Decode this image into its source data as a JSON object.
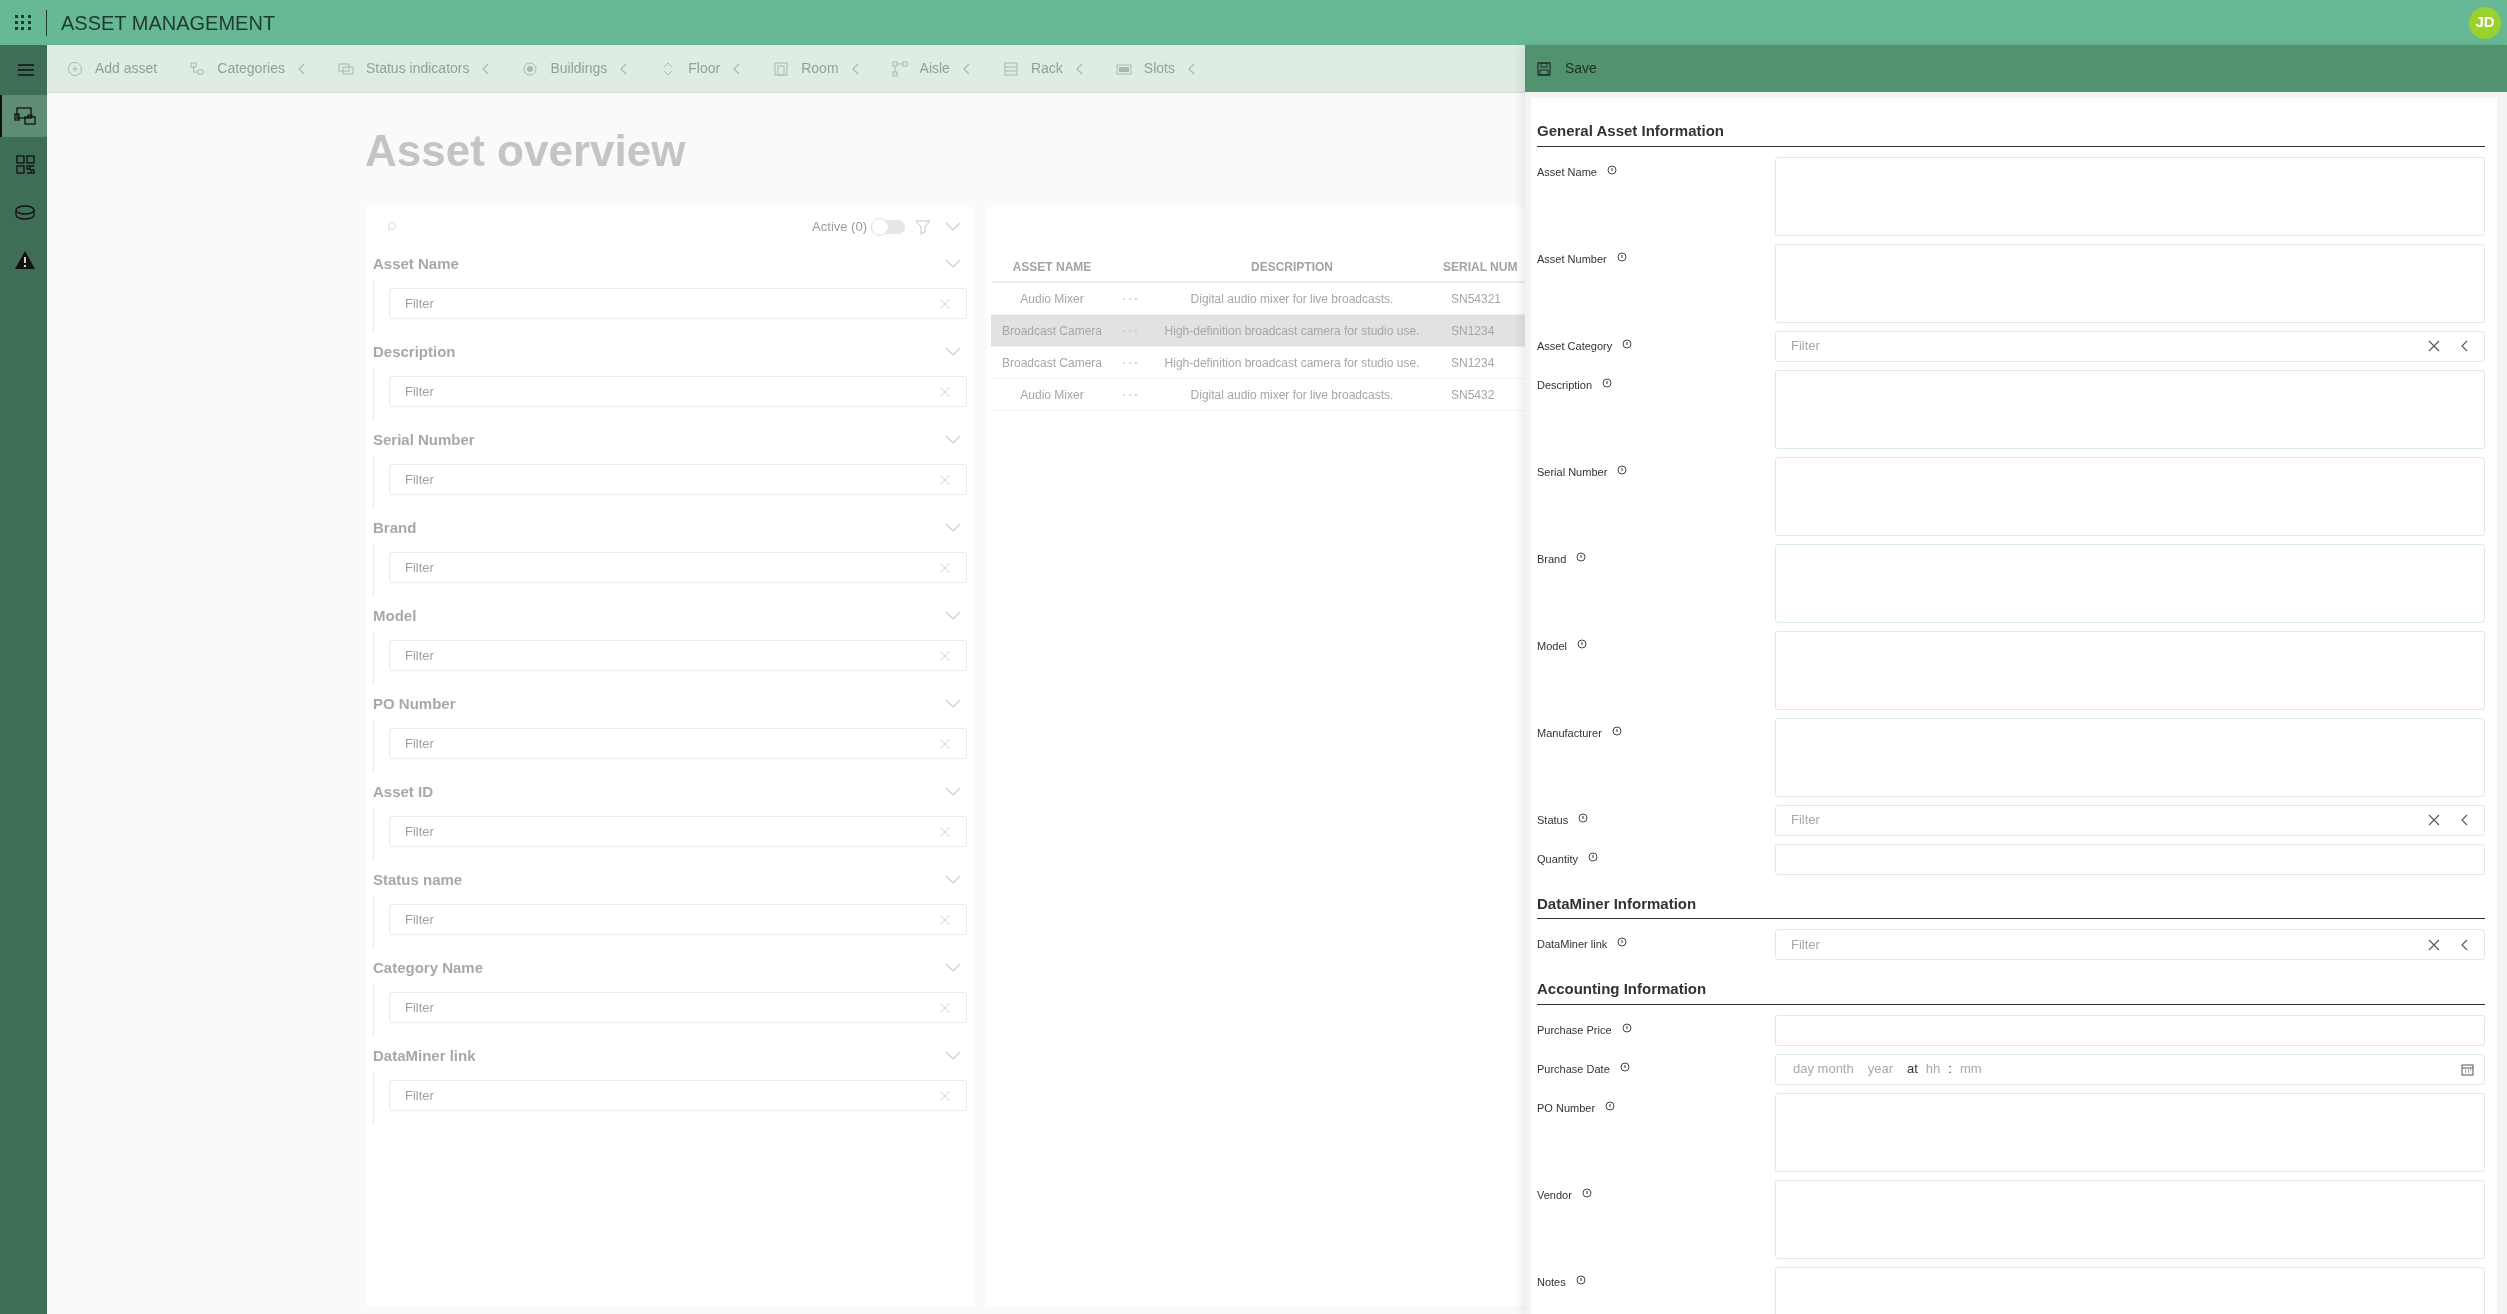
{
  "app_bar": {
    "title": "ASSET MANAGEMENT",
    "avatar": "JD"
  },
  "nav": [
    {
      "selected": false
    },
    {
      "selected": true
    },
    {
      "selected": false
    },
    {
      "selected": false
    },
    {
      "selected": false
    }
  ],
  "toolbar": [
    {
      "label": "Add asset",
      "kind": "button"
    },
    {
      "label": "Categories",
      "kind": "menu"
    },
    {
      "label": "Status indicators",
      "kind": "menu"
    },
    {
      "label": "Buildings",
      "kind": "menu"
    },
    {
      "label": "Floor",
      "kind": "menu"
    },
    {
      "label": "Room",
      "kind": "menu"
    },
    {
      "label": "Aisle",
      "kind": "menu"
    },
    {
      "label": "Rack",
      "kind": "menu"
    },
    {
      "label": "Slots",
      "kind": "menu"
    }
  ],
  "page_title": "Asset overview",
  "filters": {
    "active_label": "Active (0)",
    "active_on": false,
    "items": [
      {
        "label": "Asset Name",
        "placeholder": "Filter"
      },
      {
        "label": "Description",
        "placeholder": "Filter"
      },
      {
        "label": "Serial Number",
        "placeholder": "Filter"
      },
      {
        "label": "Brand",
        "placeholder": "Filter"
      },
      {
        "label": "Model",
        "placeholder": "Filter"
      },
      {
        "label": "PO Number",
        "placeholder": "Filter"
      },
      {
        "label": "Asset ID",
        "placeholder": "Filter"
      },
      {
        "label": "Status name",
        "placeholder": "Filter"
      },
      {
        "label": "Category Name",
        "placeholder": "Filter"
      },
      {
        "label": "DataMiner link",
        "placeholder": "Filter"
      }
    ]
  },
  "table": {
    "columns": [
      "ASSET NAME",
      "DESCRIPTION",
      "SERIAL NUM"
    ],
    "rows": [
      {
        "cells": [
          "Audio Mixer",
          "Digital audio mixer for live broadcasts.",
          "SN54321"
        ],
        "selected": false
      },
      {
        "cells": [
          "Broadcast Camera",
          "High-definition broadcast camera for studio use.",
          "SN1234"
        ],
        "selected": true
      },
      {
        "cells": [
          "Broadcast Camera",
          "High-definition broadcast camera for studio use.",
          "SN1234"
        ],
        "selected": false
      },
      {
        "cells": [
          "Audio Mixer",
          "Digital audio mixer for live broadcasts.",
          "SN5432"
        ],
        "selected": false
      }
    ]
  },
  "side_panel": {
    "save_label": "Save",
    "sections": [
      {
        "title": "General Asset Information",
        "fields": [
          {
            "label": "Asset Name",
            "kind": "textarea"
          },
          {
            "label": "Asset Number",
            "kind": "textarea"
          },
          {
            "label": "Asset Category",
            "kind": "combo",
            "placeholder": "Filter"
          },
          {
            "label": "Description",
            "kind": "textarea"
          },
          {
            "label": "Serial Number",
            "kind": "textarea"
          },
          {
            "label": "Brand",
            "kind": "textarea"
          },
          {
            "label": "Model",
            "kind": "textarea"
          },
          {
            "label": "Manufacturer",
            "kind": "textarea"
          },
          {
            "label": "Status",
            "kind": "combo",
            "placeholder": "Filter"
          },
          {
            "label": "Quantity",
            "kind": "text"
          }
        ]
      },
      {
        "title": "DataMiner Information",
        "fields": [
          {
            "label": "DataMiner link",
            "kind": "combo",
            "placeholder": "Filter"
          }
        ]
      },
      {
        "title": "Accounting Information",
        "fields": [
          {
            "label": "Purchase Price",
            "kind": "text"
          },
          {
            "label": "Purchase Date",
            "kind": "date",
            "parts": [
              {
                "text": "day month",
                "kind": "placeholder"
              },
              {
                "text": "year",
                "kind": "placeholder"
              },
              {
                "text": "at",
                "kind": "separator"
              },
              {
                "text": "hh",
                "kind": "placeholder"
              },
              {
                "text": ":",
                "kind": "separator"
              },
              {
                "text": "mm",
                "kind": "placeholder"
              }
            ]
          },
          {
            "label": "PO Number",
            "kind": "textarea"
          },
          {
            "label": "Vendor",
            "kind": "textarea"
          },
          {
            "label": "Notes",
            "kind": "textarea"
          }
        ]
      }
    ]
  }
}
